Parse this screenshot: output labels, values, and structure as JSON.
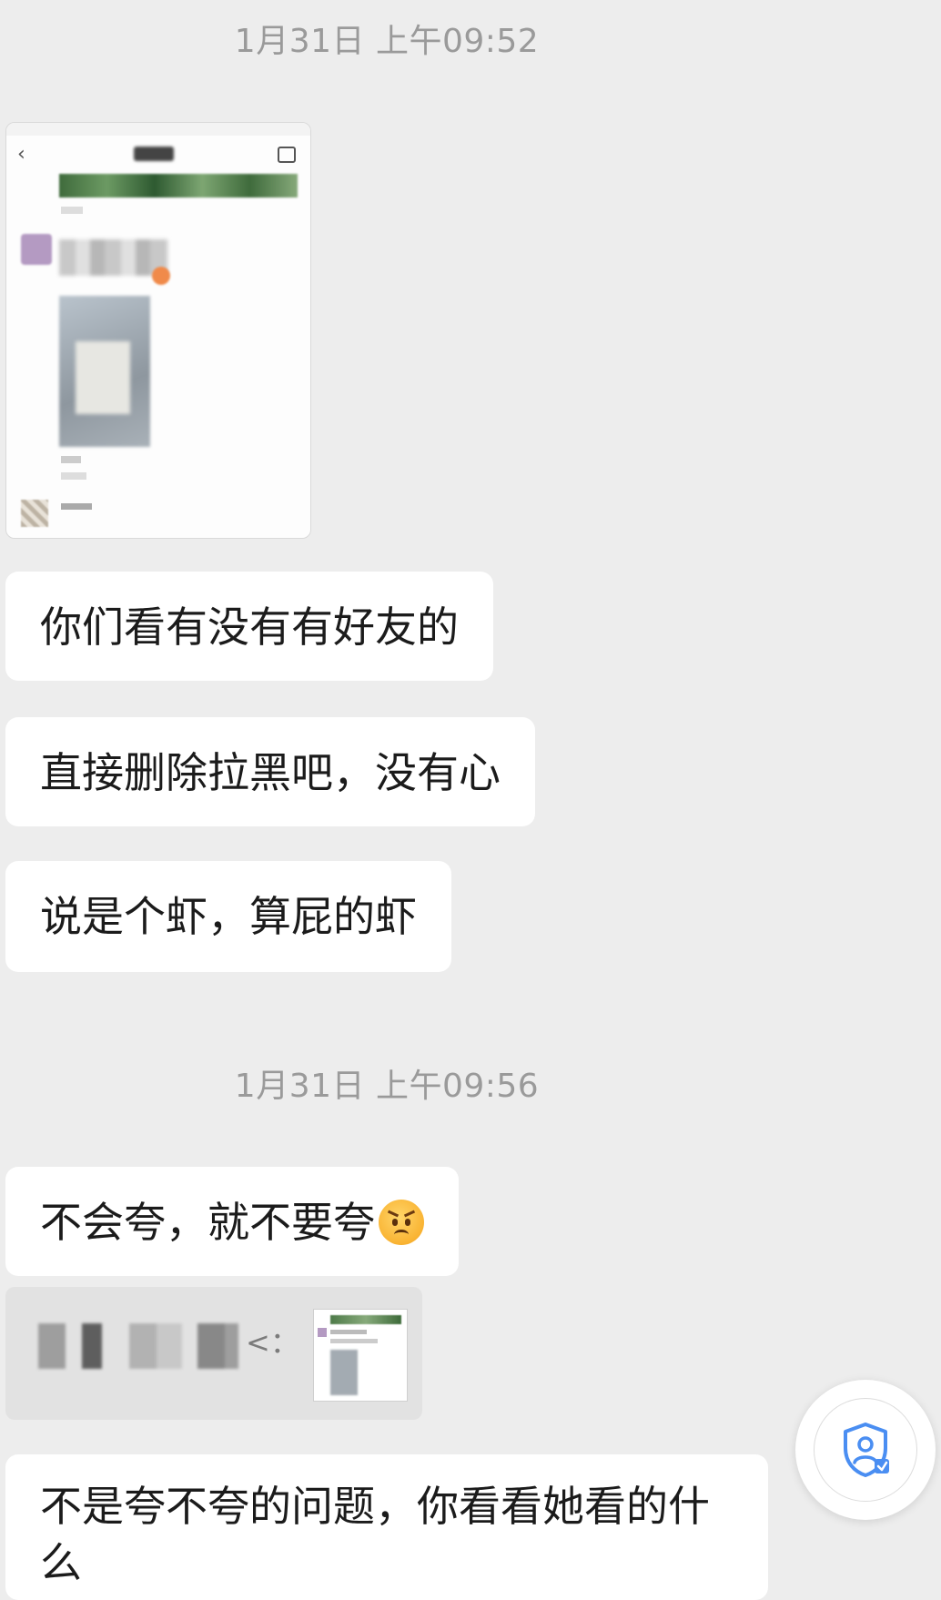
{
  "timestamps": [
    "1月31日 上午09:52",
    "1月31日 上午09:56"
  ],
  "messages": {
    "m1": "你们看有没有有好友的",
    "m2": "直接删除拉黑吧，没有心",
    "m3": "说是个虾，算屁的虾",
    "m4": "不会夸，就不要夸",
    "m5": "不是夸不夸的问题，你看看她看的什么"
  },
  "emoji": "angry-face",
  "quote": {
    "visible_suffix": "<："
  },
  "icons": {
    "fab": "shield-user-icon"
  },
  "colors": {
    "background": "#ededed",
    "bubble": "#ffffff",
    "timestamp": "#9a9a9a",
    "fab_icon": "#4a8ef2"
  }
}
